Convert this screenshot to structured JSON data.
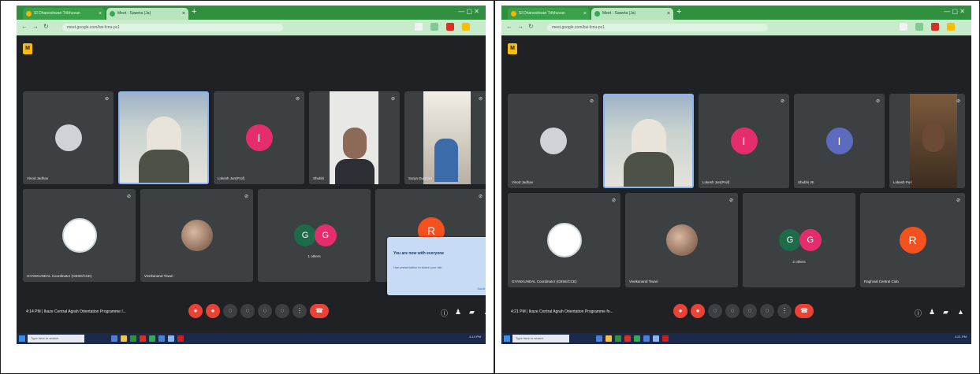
{
  "panels": [
    {
      "tabs": [
        "SI Dhaneshwari Tribhuvan",
        "Meet - Saweta (Ja)"
      ],
      "url": "meet.google.com/bsi-fcnu-pc1",
      "tiles": [
        {
          "name": "Vinod Jadhav",
          "kind": "photo-old",
          "muted": true
        },
        {
          "name": "",
          "kind": "photo-elder",
          "muted": false
        },
        {
          "name": "Lokesh Jun(Prof)",
          "kind": "letter",
          "letter": "I",
          "color": "#e52d6d",
          "muted": true
        },
        {
          "name": "Shubhi",
          "kind": "photo-man",
          "muted": true
        },
        {
          "name": "Surya Gulshan",
          "kind": "photo-room",
          "muted": true
        },
        {
          "name": "GYANKUNDAL Coordinator (CBSE/CCE)",
          "kind": "logo",
          "muted": true
        },
        {
          "name": "Vivekanand Tiwari",
          "kind": "avatar-couple",
          "muted": true
        },
        {
          "name": "1 others",
          "kind": "letters",
          "letters": [
            "G",
            "G"
          ],
          "muted": false
        },
        {
          "name": "",
          "kind": "letter",
          "letter": "R",
          "color": "#f4511e",
          "muted": true
        }
      ],
      "popup": {
        "title": "You are now with everyone",
        "text": "Use presentation to share your tab",
        "button": "Got it"
      },
      "meeting_info": "4:14 PM  |  Ikaze Central Agrah Orientation Programme I...",
      "search_placeholder": "Type here to search",
      "clock": "4:14 PM"
    },
    {
      "tabs": [
        "SI Dhaneshwari Tribhuvan",
        "Meet - Saweta (Ja)"
      ],
      "url": "meet.google.com/bsi-fcnu-pc1",
      "tiles": [
        {
          "name": "Vinod Jadhav",
          "kind": "photo-old",
          "muted": true
        },
        {
          "name": "",
          "kind": "photo-elder",
          "muted": false
        },
        {
          "name": "Lokesh Jun(Prof)",
          "kind": "letter",
          "letter": "I",
          "color": "#e52d6d",
          "muted": true
        },
        {
          "name": "Shubhi JK",
          "kind": "letter",
          "letter": "I",
          "color": "#5c6bc0",
          "muted": true
        },
        {
          "name": "Lokesh Puri",
          "kind": "photo-dark",
          "muted": true
        },
        {
          "name": "GYANKUNDAL Coordinator (CBSE/CCE)",
          "kind": "logo",
          "muted": true
        },
        {
          "name": "Vivekanand Tiwari",
          "kind": "avatar-couple",
          "muted": true
        },
        {
          "name": "2 others",
          "kind": "letters",
          "letters": [
            "G",
            "G"
          ],
          "muted": false
        },
        {
          "name": "Raghvial Central Club",
          "kind": "letter",
          "letter": "R",
          "color": "#f4511e",
          "muted": true
        }
      ],
      "meeting_info": "4:21 PM  |  Ikaze Central Agrah Orientation Programme fo...",
      "search_placeholder": "Type here to search",
      "clock": "4:21 PM"
    }
  ],
  "colors": {
    "meet_bg": "#202124",
    "tile_bg": "#3c4043",
    "chrome_green": "#2f8f3f",
    "end_red": "#ea4335"
  }
}
